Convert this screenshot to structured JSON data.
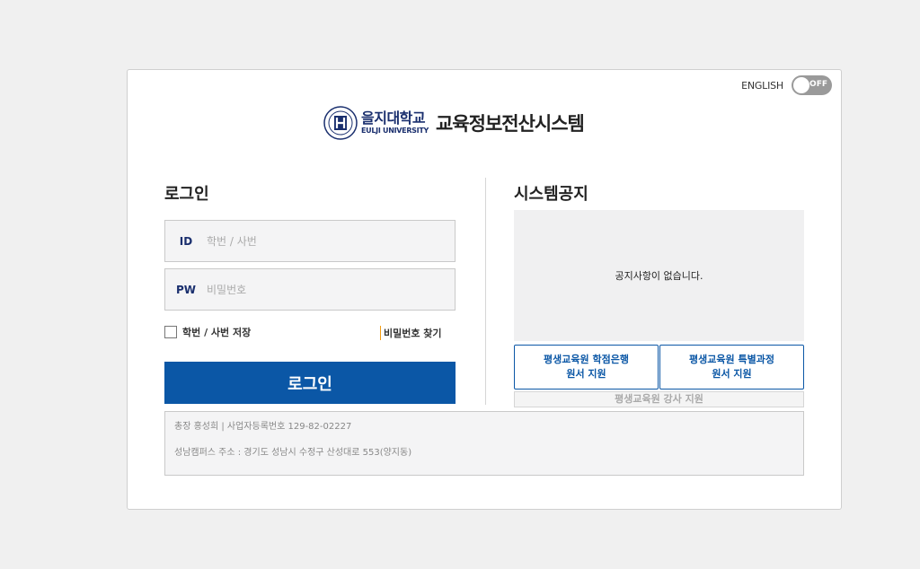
{
  "lang": {
    "label": "ENGLISH",
    "toggle_state": "OFF"
  },
  "brand": {
    "university_ko": "을지대학교",
    "university_en": "EULJI UNIVERSITY",
    "system_title": "교육정보전산시스템"
  },
  "login": {
    "heading": "로그인",
    "id_label": "ID",
    "id_placeholder": "학번 / 사번",
    "pw_label": "PW",
    "pw_placeholder": "비밀번호",
    "save_label": "학번 / 사번 저장",
    "find_pw": "비밀번호 찾기",
    "button": "로그인"
  },
  "notice": {
    "heading": "시스템공지",
    "empty_text": "공지사항이 없습니다."
  },
  "links": {
    "credit_bank_line1": "평생교육원 학점은행",
    "credit_bank_line2": "원서 지원",
    "special_course_line1": "평생교육원 특별과정",
    "special_course_line2": "원서 지원",
    "instructor": "평생교육원 강사 지원"
  },
  "footer": {
    "line1": "총장 홍성희 | 사업자등록번호 129-82-02227",
    "line2": "성남캠퍼스 주소 : 경기도 성남시 수정구 산성대로 553(양지동)"
  },
  "colors": {
    "primary": "#0b57a6",
    "brand_navy": "#1a2f6e",
    "toggle_off": "#9a9a9a"
  }
}
